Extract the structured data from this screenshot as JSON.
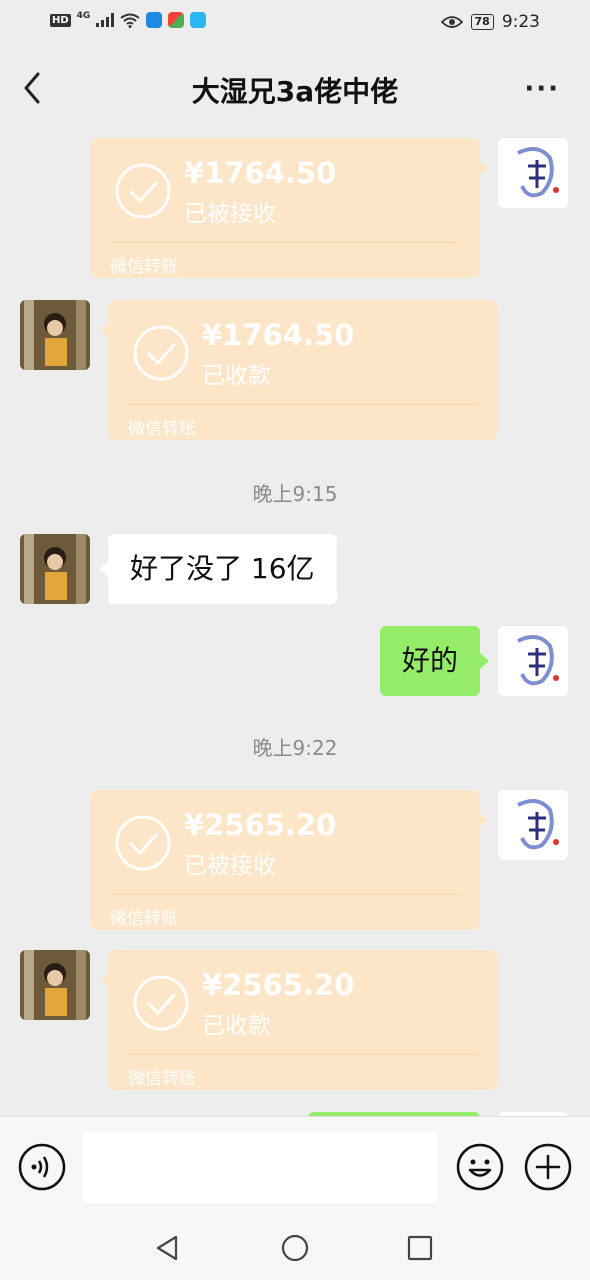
{
  "status_bar": {
    "network_hd": "HD",
    "network_type": "4G",
    "battery": "78",
    "time": "9:23",
    "icons": [
      "signal-icon",
      "wifi-icon",
      "cloud-icon",
      "app-icon",
      "search-app-icon",
      "eye-icon",
      "battery-icon"
    ]
  },
  "header": {
    "title": "大湿兄3a佬中佬",
    "more_label": "···"
  },
  "messages": {
    "m1": {
      "sender": "self",
      "type": "transfer",
      "amount": "¥1764.50",
      "status": "已被接收",
      "footer": "微信转账"
    },
    "m2": {
      "sender": "other",
      "type": "transfer",
      "amount": "¥1764.50",
      "status": "已收款",
      "footer": "微信转账"
    },
    "t1": "晚上9:15",
    "m3": {
      "sender": "other",
      "type": "text",
      "text": "好了没了 16亿"
    },
    "m4": {
      "sender": "self",
      "type": "text",
      "text": "好的"
    },
    "t2": "晚上9:22",
    "m5": {
      "sender": "self",
      "type": "transfer",
      "amount": "¥2565.20",
      "status": "已被接收",
      "footer": "微信转账"
    },
    "m6": {
      "sender": "other",
      "type": "transfer",
      "amount": "¥2565.20",
      "status": "已收款",
      "footer": "微信转账"
    }
  },
  "input_bar": {
    "icons": [
      "voice-icon",
      "emoji-icon",
      "plus-icon"
    ],
    "text_value": ""
  },
  "nav_bar": {
    "icons": [
      "back-triangle-icon",
      "home-circle-icon",
      "recents-square-icon"
    ]
  },
  "colors": {
    "background": "#ededed",
    "transfer_bubble": "#fde5c8",
    "self_bubble": "#95ec69",
    "other_bubble": "#ffffff"
  }
}
